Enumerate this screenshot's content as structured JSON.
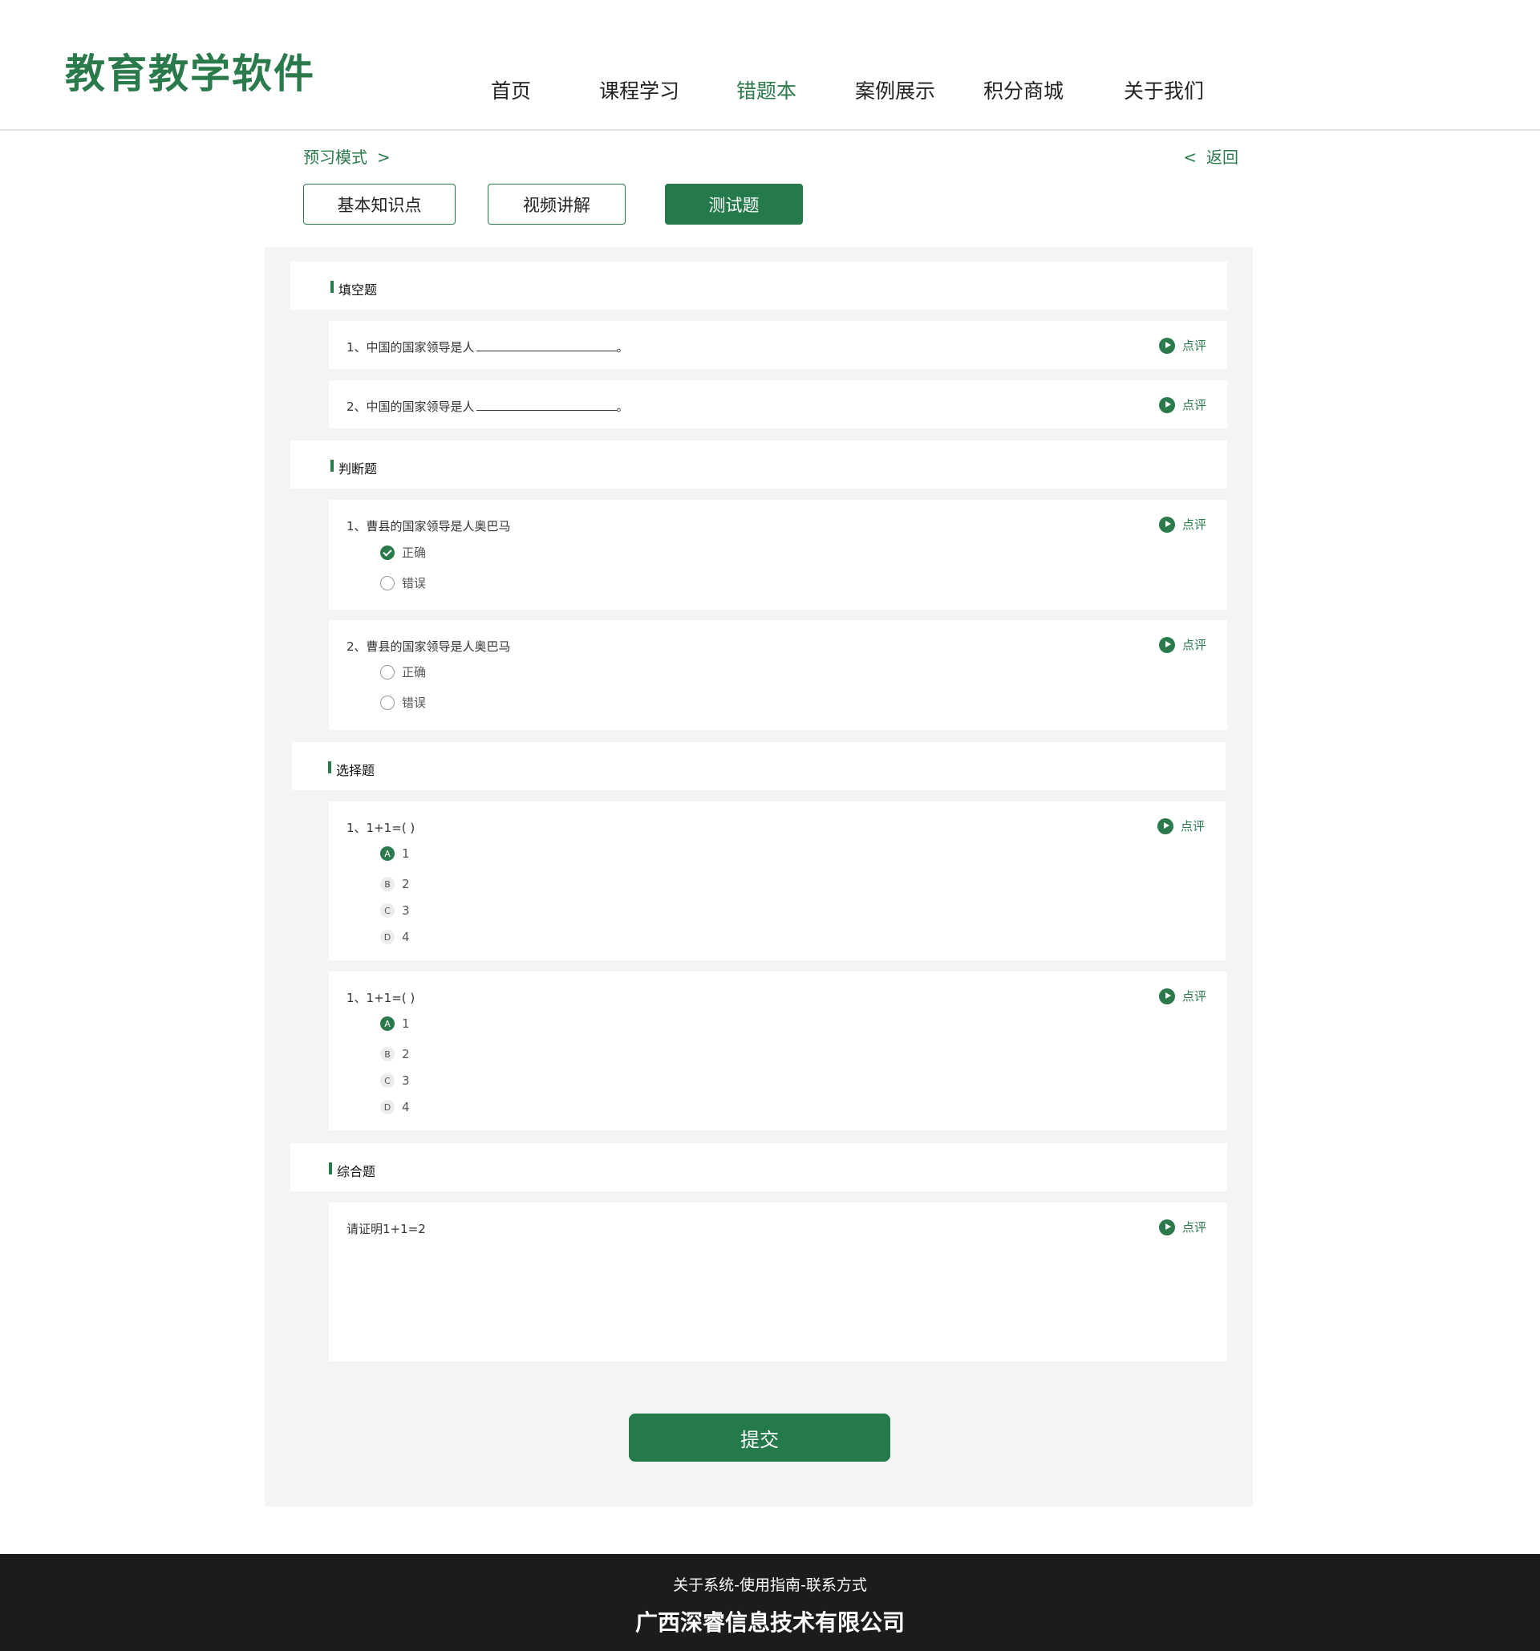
{
  "header": {
    "logo": "教育教学软件",
    "nav": [
      "首页",
      "课程学习",
      "错题本",
      "案例展示",
      "积分商城",
      "关于我们"
    ],
    "active_nav": "错题本"
  },
  "breadcrumb": {
    "label": "预习模式",
    "separator": ">"
  },
  "back": {
    "chevron": "<",
    "label": "返回"
  },
  "mode_tabs": [
    "基本知识点",
    "视频讲解",
    "测试题"
  ],
  "active_mode_tab": "测试题",
  "review_label": "点评",
  "fill_blank": {
    "title": "填空题",
    "questions": [
      {
        "text": "1、中国的国家领导是人",
        "suffix": "。"
      },
      {
        "text": "2、中国的国家领导是人",
        "suffix": "。"
      }
    ]
  },
  "judge": {
    "title": "判断题",
    "questions": [
      {
        "text": "1、曹县的国家领导是人奥巴马",
        "options": [
          "正确",
          "错误"
        ],
        "selected": "正确"
      },
      {
        "text": "2、曹县的国家领导是人奥巴马",
        "options": [
          "正确",
          "错误"
        ],
        "selected": null
      }
    ]
  },
  "choice": {
    "title": "选择题",
    "questions": [
      {
        "text": "1、1+1=( )",
        "options": [
          {
            "letter": "A",
            "text": "1"
          },
          {
            "letter": "B",
            "text": "2"
          },
          {
            "letter": "C",
            "text": "3"
          },
          {
            "letter": "D",
            "text": "4"
          }
        ],
        "selected": "A"
      },
      {
        "text": "1、1+1=( )",
        "options": [
          {
            "letter": "A",
            "text": "1"
          },
          {
            "letter": "B",
            "text": "2"
          },
          {
            "letter": "C",
            "text": "3"
          },
          {
            "letter": "D",
            "text": "4"
          }
        ],
        "selected": "A"
      }
    ]
  },
  "comprehensive": {
    "title": "综合题",
    "questions": [
      {
        "text": "请证明1+1=2"
      }
    ]
  },
  "submit_label": "提交",
  "footer": {
    "links": "关于系统-使用指南-联系方式",
    "company": "广西深睿信息技术有限公司"
  },
  "colors": {
    "accent": "#2a7a4b",
    "footer_bg": "#1c1c1c",
    "panel_bg": "#f4f4f4"
  }
}
